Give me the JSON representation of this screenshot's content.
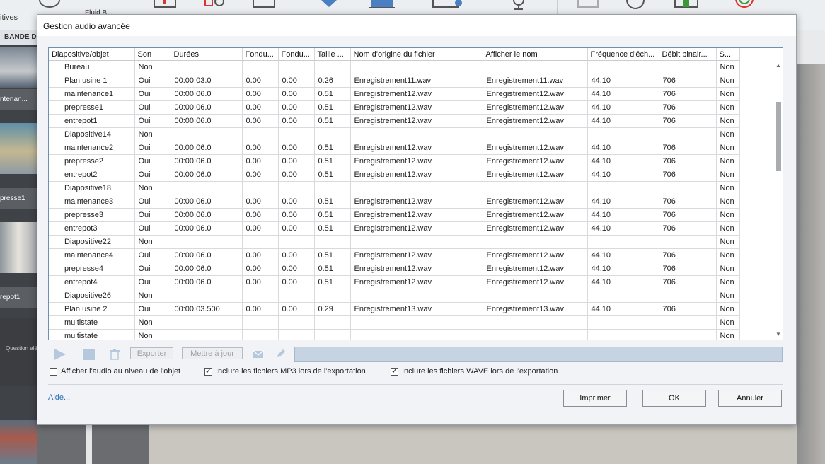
{
  "background": {
    "toolbar_labels": [
      "itives",
      "Fluid B..."
    ],
    "tab_label": "BANDE D",
    "filmstrip_labels": [
      "ntenan...",
      "presse1",
      "repot1",
      "Question aléato"
    ]
  },
  "dialog": {
    "title": "Gestion audio avancée",
    "columns": [
      "Diapositive/objet",
      "Son",
      "Durées",
      "Fondu...",
      "Fondu...",
      "Taille ...",
      "Nom d'origine du fichier",
      "Afficher le nom",
      "Fréquence d'éch...",
      "Débit binair...",
      "S..."
    ],
    "rows": [
      [
        "Bureau",
        "Non",
        "",
        "",
        "",
        "",
        "",
        "",
        "",
        "",
        "Non"
      ],
      [
        "Plan usine 1",
        "Oui",
        "00:00:03.0",
        "0.00",
        "0.00",
        "0.26",
        "Enregistrement11.wav",
        "Enregistrement11.wav",
        "44.10",
        "706",
        "Non"
      ],
      [
        "maintenance1",
        "Oui",
        "00:00:06.0",
        "0.00",
        "0.00",
        "0.51",
        "Enregistrement12.wav",
        "Enregistrement12.wav",
        "44.10",
        "706",
        "Non"
      ],
      [
        "prepresse1",
        "Oui",
        "00:00:06.0",
        "0.00",
        "0.00",
        "0.51",
        "Enregistrement12.wav",
        "Enregistrement12.wav",
        "44.10",
        "706",
        "Non"
      ],
      [
        "entrepot1",
        "Oui",
        "00:00:06.0",
        "0.00",
        "0.00",
        "0.51",
        "Enregistrement12.wav",
        "Enregistrement12.wav",
        "44.10",
        "706",
        "Non"
      ],
      [
        "Diapositive14",
        "Non",
        "",
        "",
        "",
        "",
        "",
        "",
        "",
        "",
        "Non"
      ],
      [
        "maintenance2",
        "Oui",
        "00:00:06.0",
        "0.00",
        "0.00",
        "0.51",
        "Enregistrement12.wav",
        "Enregistrement12.wav",
        "44.10",
        "706",
        "Non"
      ],
      [
        "prepresse2",
        "Oui",
        "00:00:06.0",
        "0.00",
        "0.00",
        "0.51",
        "Enregistrement12.wav",
        "Enregistrement12.wav",
        "44.10",
        "706",
        "Non"
      ],
      [
        "entrepot2",
        "Oui",
        "00:00:06.0",
        "0.00",
        "0.00",
        "0.51",
        "Enregistrement12.wav",
        "Enregistrement12.wav",
        "44.10",
        "706",
        "Non"
      ],
      [
        "Diapositive18",
        "Non",
        "",
        "",
        "",
        "",
        "",
        "",
        "",
        "",
        "Non"
      ],
      [
        "maintenance3",
        "Oui",
        "00:00:06.0",
        "0.00",
        "0.00",
        "0.51",
        "Enregistrement12.wav",
        "Enregistrement12.wav",
        "44.10",
        "706",
        "Non"
      ],
      [
        "prepresse3",
        "Oui",
        "00:00:06.0",
        "0.00",
        "0.00",
        "0.51",
        "Enregistrement12.wav",
        "Enregistrement12.wav",
        "44.10",
        "706",
        "Non"
      ],
      [
        "entrepot3",
        "Oui",
        "00:00:06.0",
        "0.00",
        "0.00",
        "0.51",
        "Enregistrement12.wav",
        "Enregistrement12.wav",
        "44.10",
        "706",
        "Non"
      ],
      [
        "Diapositive22",
        "Non",
        "",
        "",
        "",
        "",
        "",
        "",
        "",
        "",
        "Non"
      ],
      [
        "maintenance4",
        "Oui",
        "00:00:06.0",
        "0.00",
        "0.00",
        "0.51",
        "Enregistrement12.wav",
        "Enregistrement12.wav",
        "44.10",
        "706",
        "Non"
      ],
      [
        "prepresse4",
        "Oui",
        "00:00:06.0",
        "0.00",
        "0.00",
        "0.51",
        "Enregistrement12.wav",
        "Enregistrement12.wav",
        "44.10",
        "706",
        "Non"
      ],
      [
        "entrepot4",
        "Oui",
        "00:00:06.0",
        "0.00",
        "0.00",
        "0.51",
        "Enregistrement12.wav",
        "Enregistrement12.wav",
        "44.10",
        "706",
        "Non"
      ],
      [
        "Diapositive26",
        "Non",
        "",
        "",
        "",
        "",
        "",
        "",
        "",
        "",
        "Non"
      ],
      [
        "Plan usine 2",
        "Oui",
        "00:00:03.500",
        "0.00",
        "0.00",
        "0.29",
        "Enregistrement13.wav",
        "Enregistrement13.wav",
        "44.10",
        "706",
        "Non"
      ],
      [
        "multistate",
        "Non",
        "",
        "",
        "",
        "",
        "",
        "",
        "",
        "",
        "Non"
      ],
      [
        "multistate",
        "Non",
        "",
        "",
        "",
        "",
        "",
        "",
        "",
        "",
        "Non"
      ]
    ],
    "toolbar": {
      "export_label": "Exporter",
      "update_label": "Mettre à jour"
    },
    "checkboxes": [
      {
        "label": "Afficher l'audio au niveau de l'objet",
        "checked": false
      },
      {
        "label": "Inclure les fichiers MP3 lors de l'exportation",
        "checked": true
      },
      {
        "label": "Inclure les fichiers WAVE lors de l'exportation",
        "checked": true
      }
    ],
    "help_label": "Aide...",
    "print_label": "Imprimer",
    "ok_label": "OK",
    "cancel_label": "Annuler"
  },
  "colors": {
    "accent_blue": "#4a7fc1",
    "progress_fill": "#c6d3e2",
    "link": "#2a6fb8"
  }
}
